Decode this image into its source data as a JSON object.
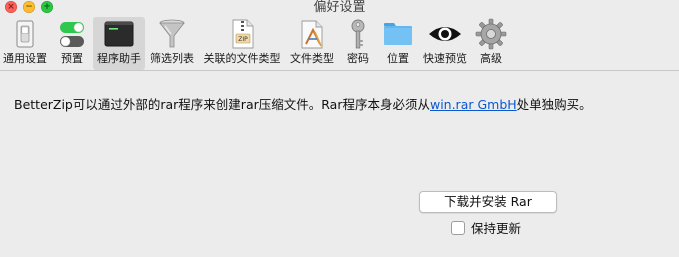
{
  "window": {
    "title": "偏好设置",
    "controls": {
      "close_glyph": "×",
      "minimize_glyph": "−",
      "zoom_glyph": "+"
    }
  },
  "toolbar": {
    "items": [
      {
        "label": "通用设置",
        "icon": "switch-icon"
      },
      {
        "label": "预置",
        "icon": "toggles-icon"
      },
      {
        "label": "程序助手",
        "icon": "terminal-icon",
        "selected": true
      },
      {
        "label": "筛选列表",
        "icon": "funnel-icon"
      },
      {
        "label": "关联的文件类型",
        "icon": "zip-document-icon"
      },
      {
        "label": "文件类型",
        "icon": "document-app-icon"
      },
      {
        "label": "密码",
        "icon": "key-icon"
      },
      {
        "label": "位置",
        "icon": "folder-icon"
      },
      {
        "label": "快速预览",
        "icon": "eye-icon"
      },
      {
        "label": "高级",
        "icon": "gear-icon"
      }
    ],
    "zip_badge": "ZIP"
  },
  "content": {
    "message_before_link": "BetterZip可以通过外部的rar程序来创建rar压缩文件。Rar程序本身必须从",
    "link_text": "win.rar GmbH",
    "message_after_link": "处单独购买。",
    "install_button": "下载并安装 Rar",
    "keep_updated": {
      "label": "保持更新",
      "checked": false
    }
  },
  "colors": {
    "link": "#0b57d0",
    "selected_tab": "#d6d6d6",
    "background": "#ececec"
  }
}
